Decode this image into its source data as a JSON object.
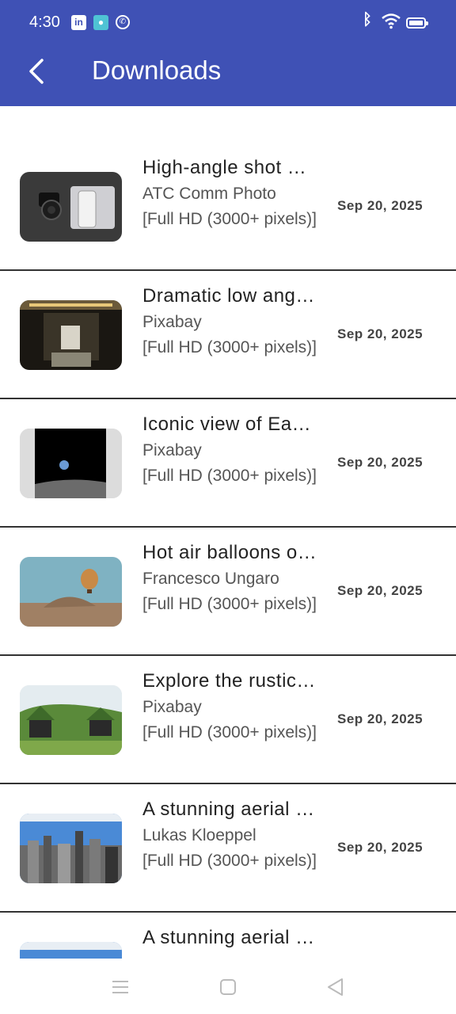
{
  "status_bar": {
    "time": "4:30",
    "icons": [
      "linkedin-icon",
      "app-notification-icon",
      "whatsapp-icon",
      "bluetooth-icon",
      "wifi-icon",
      "battery-icon"
    ]
  },
  "header": {
    "title": "Downloads",
    "back_icon": "chevron-left-icon",
    "background_color": "#3f51b5"
  },
  "downloads": [
    {
      "title": "High-angle shot of camera and phone",
      "author": "ATC Comm Photo",
      "resolution": " [Full HD (3000+ pixels)]",
      "date": "Sep 20, 2025"
    },
    {
      "title": "Dramatic low angle view of memorial",
      "author": "Pixabay",
      "resolution": " [Full HD (3000+ pixels)]",
      "date": "Sep 20, 2025"
    },
    {
      "title": "Iconic view of Earth from the moon",
      "author": "Pixabay",
      "resolution": " [Full HD (3000+ pixels)]",
      "date": "Sep 20, 2025"
    },
    {
      "title": "Hot air balloons over landscape",
      "author": "Francesco Ungaro",
      "resolution": " [Full HD (3000+ pixels)]",
      "date": "Sep 20, 2025"
    },
    {
      "title": "Explore the rustic turf houses",
      "author": "Pixabay",
      "resolution": " [Full HD (3000+ pixels)]",
      "date": "Sep 20, 2025"
    },
    {
      "title": "A stunning aerial view of city skyline",
      "author": "Lukas Kloeppel",
      "resolution": " [Full HD (3000+ pixels)]",
      "date": "Sep 20, 2025"
    },
    {
      "title": "A stunning aerial view of skyline",
      "author": "",
      "resolution": "",
      "date": ""
    }
  ],
  "nav_bar": {
    "icons": [
      "menu-icon",
      "home-icon",
      "back-triangle-icon"
    ]
  }
}
